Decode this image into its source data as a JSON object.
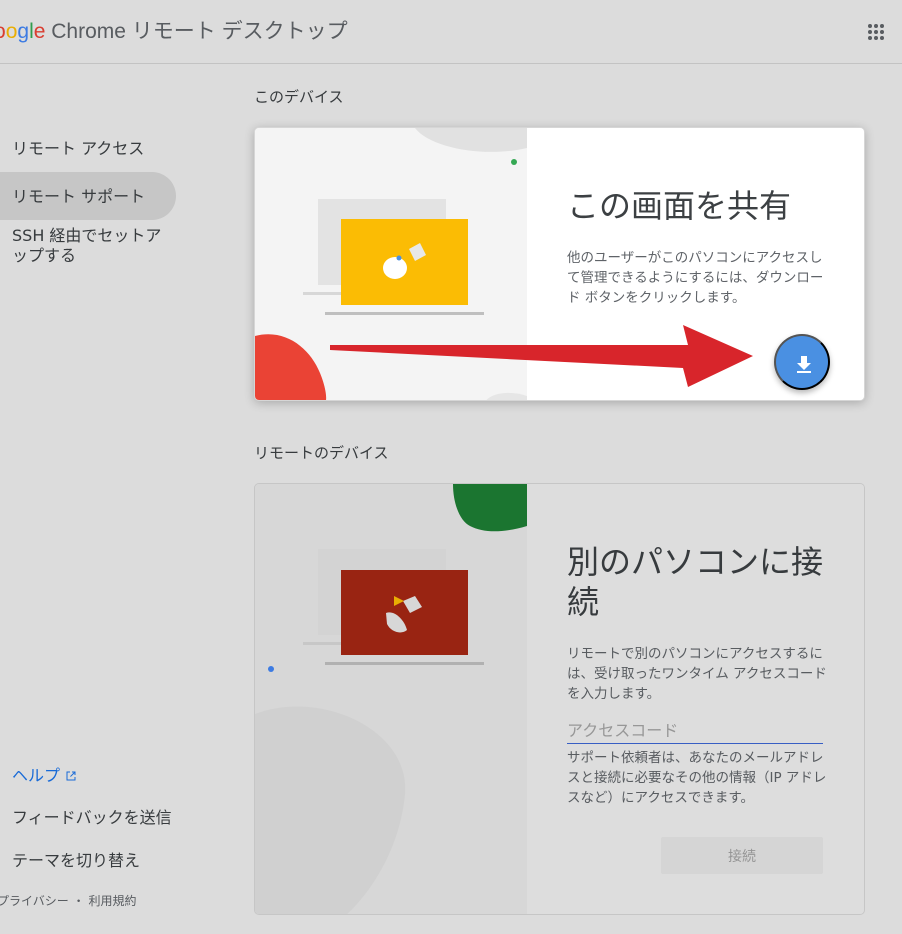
{
  "header": {
    "brand_prefix": {
      "o1": "o",
      "o2": "o",
      "g": "g",
      "l": "l",
      "e": "e"
    },
    "brand_name": "Chrome リモート デスクトップ",
    "apps_icon": "apps-grid-icon"
  },
  "nav": {
    "items": [
      {
        "label": "リモート アクセス"
      },
      {
        "label": "リモート サポート"
      },
      {
        "label": "SSH 経由でセットア\nップする"
      }
    ],
    "help": "ヘルプ",
    "feedback": "フィードバックを送信",
    "theme": "テーマを切り替え",
    "privacy": "プライバシー",
    "separator": "・",
    "terms": "利用規約"
  },
  "sections": {
    "this_device": "このデバイス",
    "remote_devices": "リモートのデバイス"
  },
  "share_card": {
    "title": "この画面を共有",
    "description": "他のユーザーがこのパソコンにアクセスして管理できるようにするには、ダウンロード ボタンをクリックします。",
    "button_icon": "download-icon"
  },
  "connect_card": {
    "title": "別のパソコンに接続",
    "description": "リモートで別のパソコンにアクセスするには、受け取ったワンタイム アクセスコードを入力します。",
    "access_code_placeholder": "アクセスコード",
    "helper": "サポート依頼者は、あなたのメールアドレスと接続に必要なその他の情報（IP アドレスなど）にアクセスできます。",
    "connect_label": "接続"
  },
  "colors": {
    "accent_blue": "#4a90e2",
    "arrow_red": "#d8252b",
    "screen_yellow": "#fbbc04",
    "screen_red": "#a52714",
    "green": "#1e8e3e"
  }
}
